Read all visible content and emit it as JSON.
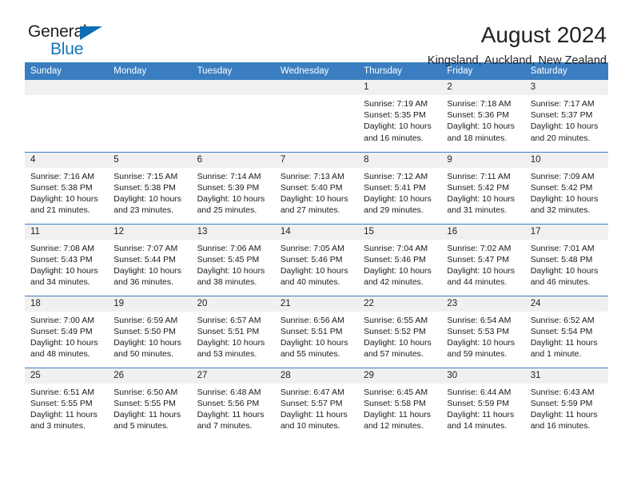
{
  "brand": {
    "name_top": "General",
    "name_bottom": "Blue",
    "triangle_icon": "triangle-icon",
    "color_dark": "#231f20",
    "color_blue": "#1175bc"
  },
  "header": {
    "title": "August 2024",
    "subtitle": "Kingsland, Auckland, New Zealand"
  },
  "theme": {
    "header_bg": "#3a7ec1",
    "header_text": "#ffffff",
    "daynum_bg": "#f0f0f0",
    "cell_bg": "#ffffff",
    "row_divider": "#3a7ec1"
  },
  "weekday_headers": [
    "Sunday",
    "Monday",
    "Tuesday",
    "Wednesday",
    "Thursday",
    "Friday",
    "Saturday"
  ],
  "weeks": [
    [
      {
        "day": "",
        "empty": true
      },
      {
        "day": "",
        "empty": true
      },
      {
        "day": "",
        "empty": true
      },
      {
        "day": "",
        "empty": true
      },
      {
        "day": "1",
        "sunrise": "Sunrise: 7:19 AM",
        "sunset": "Sunset: 5:35 PM",
        "daylight": "Daylight: 10 hours and 16 minutes."
      },
      {
        "day": "2",
        "sunrise": "Sunrise: 7:18 AM",
        "sunset": "Sunset: 5:36 PM",
        "daylight": "Daylight: 10 hours and 18 minutes."
      },
      {
        "day": "3",
        "sunrise": "Sunrise: 7:17 AM",
        "sunset": "Sunset: 5:37 PM",
        "daylight": "Daylight: 10 hours and 20 minutes."
      }
    ],
    [
      {
        "day": "4",
        "sunrise": "Sunrise: 7:16 AM",
        "sunset": "Sunset: 5:38 PM",
        "daylight": "Daylight: 10 hours and 21 minutes."
      },
      {
        "day": "5",
        "sunrise": "Sunrise: 7:15 AM",
        "sunset": "Sunset: 5:38 PM",
        "daylight": "Daylight: 10 hours and 23 minutes."
      },
      {
        "day": "6",
        "sunrise": "Sunrise: 7:14 AM",
        "sunset": "Sunset: 5:39 PM",
        "daylight": "Daylight: 10 hours and 25 minutes."
      },
      {
        "day": "7",
        "sunrise": "Sunrise: 7:13 AM",
        "sunset": "Sunset: 5:40 PM",
        "daylight": "Daylight: 10 hours and 27 minutes."
      },
      {
        "day": "8",
        "sunrise": "Sunrise: 7:12 AM",
        "sunset": "Sunset: 5:41 PM",
        "daylight": "Daylight: 10 hours and 29 minutes."
      },
      {
        "day": "9",
        "sunrise": "Sunrise: 7:11 AM",
        "sunset": "Sunset: 5:42 PM",
        "daylight": "Daylight: 10 hours and 31 minutes."
      },
      {
        "day": "10",
        "sunrise": "Sunrise: 7:09 AM",
        "sunset": "Sunset: 5:42 PM",
        "daylight": "Daylight: 10 hours and 32 minutes."
      }
    ],
    [
      {
        "day": "11",
        "sunrise": "Sunrise: 7:08 AM",
        "sunset": "Sunset: 5:43 PM",
        "daylight": "Daylight: 10 hours and 34 minutes."
      },
      {
        "day": "12",
        "sunrise": "Sunrise: 7:07 AM",
        "sunset": "Sunset: 5:44 PM",
        "daylight": "Daylight: 10 hours and 36 minutes."
      },
      {
        "day": "13",
        "sunrise": "Sunrise: 7:06 AM",
        "sunset": "Sunset: 5:45 PM",
        "daylight": "Daylight: 10 hours and 38 minutes."
      },
      {
        "day": "14",
        "sunrise": "Sunrise: 7:05 AM",
        "sunset": "Sunset: 5:46 PM",
        "daylight": "Daylight: 10 hours and 40 minutes."
      },
      {
        "day": "15",
        "sunrise": "Sunrise: 7:04 AM",
        "sunset": "Sunset: 5:46 PM",
        "daylight": "Daylight: 10 hours and 42 minutes."
      },
      {
        "day": "16",
        "sunrise": "Sunrise: 7:02 AM",
        "sunset": "Sunset: 5:47 PM",
        "daylight": "Daylight: 10 hours and 44 minutes."
      },
      {
        "day": "17",
        "sunrise": "Sunrise: 7:01 AM",
        "sunset": "Sunset: 5:48 PM",
        "daylight": "Daylight: 10 hours and 46 minutes."
      }
    ],
    [
      {
        "day": "18",
        "sunrise": "Sunrise: 7:00 AM",
        "sunset": "Sunset: 5:49 PM",
        "daylight": "Daylight: 10 hours and 48 minutes."
      },
      {
        "day": "19",
        "sunrise": "Sunrise: 6:59 AM",
        "sunset": "Sunset: 5:50 PM",
        "daylight": "Daylight: 10 hours and 50 minutes."
      },
      {
        "day": "20",
        "sunrise": "Sunrise: 6:57 AM",
        "sunset": "Sunset: 5:51 PM",
        "daylight": "Daylight: 10 hours and 53 minutes."
      },
      {
        "day": "21",
        "sunrise": "Sunrise: 6:56 AM",
        "sunset": "Sunset: 5:51 PM",
        "daylight": "Daylight: 10 hours and 55 minutes."
      },
      {
        "day": "22",
        "sunrise": "Sunrise: 6:55 AM",
        "sunset": "Sunset: 5:52 PM",
        "daylight": "Daylight: 10 hours and 57 minutes."
      },
      {
        "day": "23",
        "sunrise": "Sunrise: 6:54 AM",
        "sunset": "Sunset: 5:53 PM",
        "daylight": "Daylight: 10 hours and 59 minutes."
      },
      {
        "day": "24",
        "sunrise": "Sunrise: 6:52 AM",
        "sunset": "Sunset: 5:54 PM",
        "daylight": "Daylight: 11 hours and 1 minute."
      }
    ],
    [
      {
        "day": "25",
        "sunrise": "Sunrise: 6:51 AM",
        "sunset": "Sunset: 5:55 PM",
        "daylight": "Daylight: 11 hours and 3 minutes."
      },
      {
        "day": "26",
        "sunrise": "Sunrise: 6:50 AM",
        "sunset": "Sunset: 5:55 PM",
        "daylight": "Daylight: 11 hours and 5 minutes."
      },
      {
        "day": "27",
        "sunrise": "Sunrise: 6:48 AM",
        "sunset": "Sunset: 5:56 PM",
        "daylight": "Daylight: 11 hours and 7 minutes."
      },
      {
        "day": "28",
        "sunrise": "Sunrise: 6:47 AM",
        "sunset": "Sunset: 5:57 PM",
        "daylight": "Daylight: 11 hours and 10 minutes."
      },
      {
        "day": "29",
        "sunrise": "Sunrise: 6:45 AM",
        "sunset": "Sunset: 5:58 PM",
        "daylight": "Daylight: 11 hours and 12 minutes."
      },
      {
        "day": "30",
        "sunrise": "Sunrise: 6:44 AM",
        "sunset": "Sunset: 5:59 PM",
        "daylight": "Daylight: 11 hours and 14 minutes."
      },
      {
        "day": "31",
        "sunrise": "Sunrise: 6:43 AM",
        "sunset": "Sunset: 5:59 PM",
        "daylight": "Daylight: 11 hours and 16 minutes."
      }
    ]
  ]
}
